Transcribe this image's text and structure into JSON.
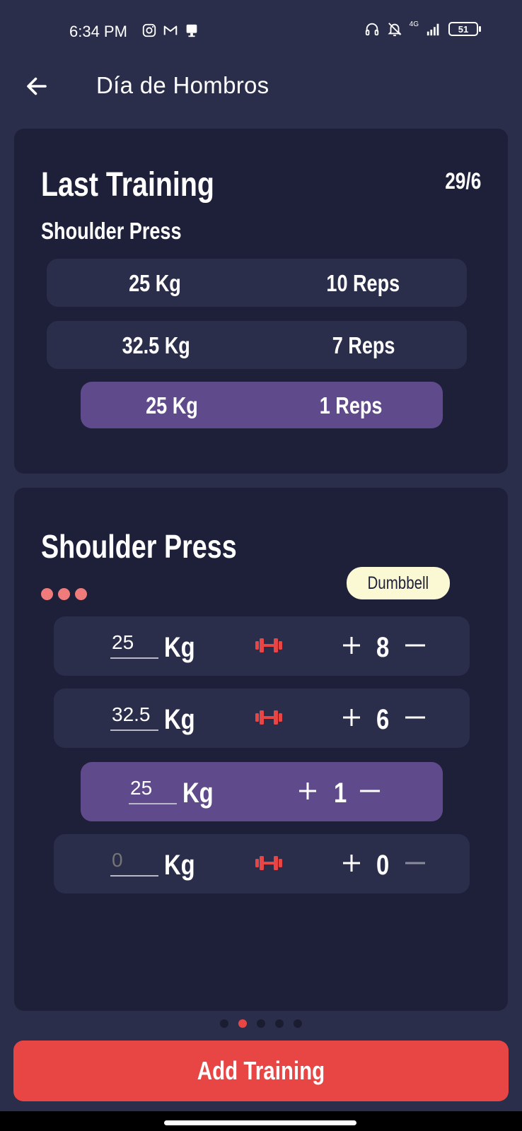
{
  "status_bar": {
    "time": "6:34 PM",
    "network": "4G",
    "battery": "51"
  },
  "app_bar": {
    "title": "Día de Hombros"
  },
  "last_training": {
    "title": "Last Training",
    "date": "29/6",
    "exercise": "Shoulder Press",
    "sets": [
      {
        "weight": "25 Kg",
        "reps": "10 Reps",
        "highlighted": false
      },
      {
        "weight": "32.5 Kg",
        "reps": "7 Reps",
        "highlighted": false
      },
      {
        "weight": "25 Kg",
        "reps": "1 Reps",
        "highlighted": true
      }
    ]
  },
  "current_exercise": {
    "title": "Shoulder Press",
    "equipment": "Dumbbell",
    "unit_label": "Kg",
    "rows": [
      {
        "weight": "25",
        "reps": "8",
        "highlighted": false,
        "has_dumbbell_icon": true
      },
      {
        "weight": "32.5",
        "reps": "6",
        "highlighted": false,
        "has_dumbbell_icon": true
      },
      {
        "weight": "25",
        "reps": "1",
        "highlighted": true,
        "has_dumbbell_icon": false
      },
      {
        "weight_placeholder": "0",
        "reps": "0",
        "highlighted": false,
        "has_dumbbell_icon": true
      }
    ]
  },
  "pager": {
    "count": 5,
    "active_index": 1
  },
  "add_button": {
    "label": "Add Training"
  },
  "colors": {
    "background": "#2b2e4b",
    "card": "#1e203a",
    "highlight": "#5f4b8b",
    "accent": "#e84545",
    "dots": "#ef7b7b",
    "badge": "#fbf8d4"
  }
}
